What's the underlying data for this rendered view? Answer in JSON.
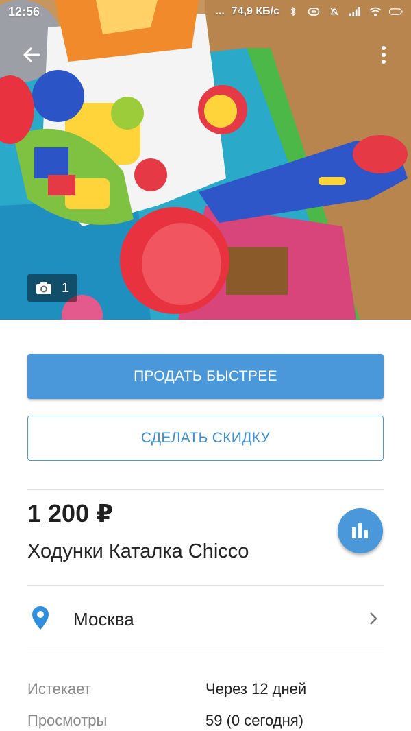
{
  "status_bar": {
    "time": "12:56",
    "dots": "...",
    "network_speed": "74,9 КБ/с"
  },
  "photo": {
    "count": "1"
  },
  "actions": {
    "sell_faster_label": "ПРОДАТЬ БЫСТРЕЕ",
    "discount_label": "СДЕЛАТЬ СКИДКУ"
  },
  "listing": {
    "price": "1 200 ₽",
    "title": "Ходунки Каталка Chicco",
    "location": "Москва"
  },
  "details": [
    {
      "label": "Истекает",
      "value": "Через 12 дней"
    },
    {
      "label": "Просмотры",
      "value": "59 (0 сегодня)"
    }
  ],
  "colors": {
    "accent": "#4a97d9"
  },
  "icons": {
    "back": "arrow-left-icon",
    "more": "more-vertical-icon",
    "camera": "camera-icon",
    "stats": "bar-chart-icon",
    "location": "location-pin-icon",
    "chevron": "chevron-right-icon"
  }
}
